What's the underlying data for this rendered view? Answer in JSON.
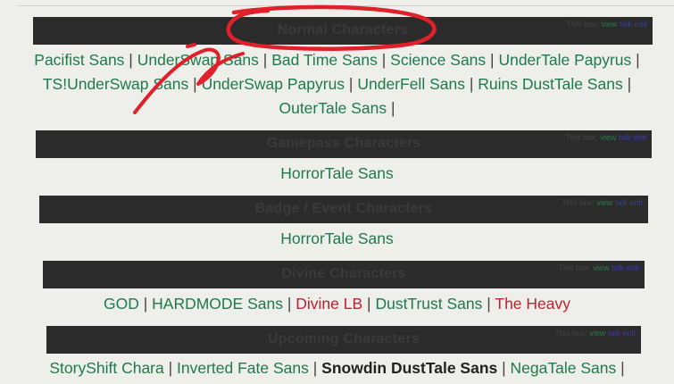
{
  "navboxes": [
    {
      "title": "Normal Characters",
      "vte": {
        "this": "This box:",
        "view": "view",
        "talk": "talk",
        "edit": "edit"
      },
      "lines": [
        [
          {
            "text": "Pacifist Sans",
            "style": "link"
          },
          {
            "text": " | ",
            "style": "sep"
          },
          {
            "text": "UnderSwap Sans",
            "style": "link"
          },
          {
            "text": " | ",
            "style": "sep"
          },
          {
            "text": "Bad Time Sans",
            "style": "link"
          },
          {
            "text": " | ",
            "style": "sep"
          },
          {
            "text": "Science Sans",
            "style": "link"
          },
          {
            "text": " | ",
            "style": "sep"
          },
          {
            "text": "UnderTale Papyrus",
            "style": "link"
          },
          {
            "text": " |",
            "style": "sep"
          }
        ],
        [
          {
            "text": "TS!UnderSwap Sans",
            "style": "link"
          },
          {
            "text": " | ",
            "style": "sep"
          },
          {
            "text": "UnderSwap Papyrus",
            "style": "link"
          },
          {
            "text": " | ",
            "style": "sep"
          },
          {
            "text": "UnderFell Sans",
            "style": "link"
          },
          {
            "text": " | ",
            "style": "sep"
          },
          {
            "text": "Ruins DustTale Sans",
            "style": "link"
          },
          {
            "text": " |",
            "style": "sep"
          }
        ],
        [
          {
            "text": "OuterTale Sans",
            "style": "link"
          },
          {
            "text": " |",
            "style": "sep"
          }
        ]
      ]
    },
    {
      "title": "Gamepass Characters",
      "vte": {
        "this": "This box:",
        "view": "view",
        "talk": "talk",
        "edit": "edit"
      },
      "lines": [
        [
          {
            "text": "HorrorTale Sans",
            "style": "link"
          }
        ]
      ]
    },
    {
      "title": "Badge / Event Characters",
      "vte": {
        "this": "This box:",
        "view": "view",
        "talk": "talk",
        "edit": "edit"
      },
      "lines": [
        [
          {
            "text": "HorrorTale Sans",
            "style": "link"
          }
        ]
      ]
    },
    {
      "title": "Divine Characters",
      "vte": {
        "this": "This box:",
        "view": "view",
        "talk": "talk",
        "edit": "edit"
      },
      "lines": [
        [
          {
            "text": "GOD",
            "style": "link"
          },
          {
            "text": " | ",
            "style": "sep"
          },
          {
            "text": "HARDMODE Sans",
            "style": "link"
          },
          {
            "text": " | ",
            "style": "sep"
          },
          {
            "text": "Divine LB",
            "style": "link-red"
          },
          {
            "text": " | ",
            "style": "sep"
          },
          {
            "text": "DustTrust Sans",
            "style": "link"
          },
          {
            "text": " | ",
            "style": "sep"
          },
          {
            "text": "The Heavy",
            "style": "link-red"
          }
        ]
      ]
    },
    {
      "title": "Upcoming Characters",
      "vte": {
        "this": "This box:",
        "view": "view",
        "talk": "talk",
        "edit": "edit"
      },
      "lines": [
        [
          {
            "text": "StoryShift Chara",
            "style": "link"
          },
          {
            "text": " | ",
            "style": "sep"
          },
          {
            "text": "Inverted Fate Sans",
            "style": "link"
          },
          {
            "text": " | ",
            "style": "sep"
          },
          {
            "text": "Snowdin DustTale Sans",
            "style": "bold"
          },
          {
            "text": " | ",
            "style": "sep"
          },
          {
            "text": "NegaTale Sans",
            "style": "link"
          },
          {
            "text": " |",
            "style": "sep"
          }
        ]
      ]
    }
  ],
  "annotation": {
    "color": "#e0202a"
  }
}
